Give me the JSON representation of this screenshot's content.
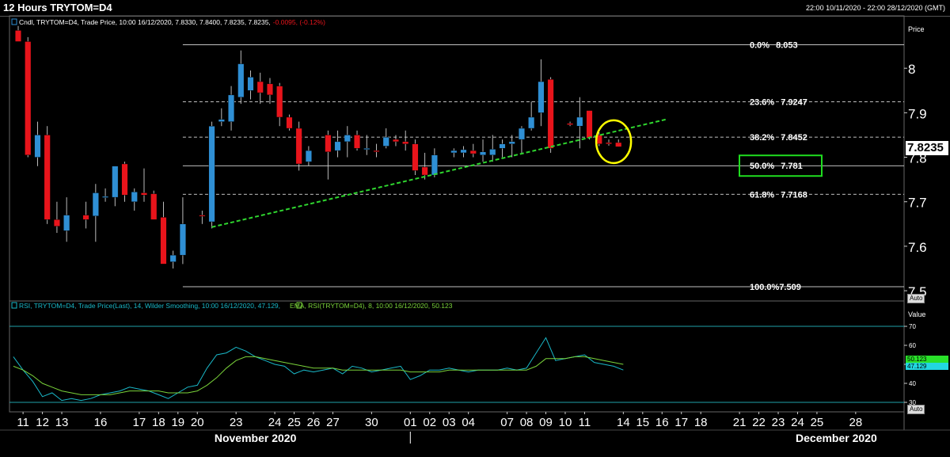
{
  "header": {
    "title": "12 Hours TRYTOM=D4",
    "date_range": "22:00 10/11/2020 - 22:00 28/12/2020 (GMT)"
  },
  "price_panel": {
    "legend_prefix": "Cndl, TRYTOM=D4, Trade Price, 10:00 16/12/2020, 7.8330, 7.8400, 7.8235, 7.8235,",
    "legend_change": "-0.0095, (-0.12%)",
    "axis_title": "Price",
    "current_price": "7.8235",
    "auto_label": "Auto"
  },
  "rsi_panel": {
    "legend_rsi": "RSI, TRYTOM=D4, Trade Price(Last), 14, Wilder Smoothing, 10:00 16/12/2020, 47.129,",
    "legend_ema": "EMA, RSI(TRYTOM=D4), 8, 10:00 16/12/2020, 50.123",
    "axis_title": "Value",
    "ema_value": "50.123",
    "rsi_value": "47.129",
    "auto_label": "Auto"
  },
  "x_axis": {
    "month_labels": [
      {
        "text": "November 2020",
        "x": 16.5
      },
      {
        "text": "December 2020",
        "x": 46.5
      }
    ]
  },
  "colors": {
    "up": "#2f8fd4",
    "down": "#e8141b",
    "trendline": "#2fd62f",
    "fib": "#ffffff",
    "highlight_circle": "#ffff00",
    "highlight_box": "#1fdc1f",
    "rsi_line": "#19b8c8",
    "ema_line": "#7ad33a",
    "rsi_bands": "#1f9fa8"
  },
  "chart_data": [
    {
      "type": "candlestick",
      "x_unit": "trading-slot index (2 twelve-hour candles per day)",
      "x_ticks": [
        {
          "x": 0.5,
          "label": "11"
        },
        {
          "x": 1.5,
          "label": "12"
        },
        {
          "x": 2.5,
          "label": "13"
        },
        {
          "x": 4.5,
          "label": "16"
        },
        {
          "x": 6.5,
          "label": "17"
        },
        {
          "x": 7.5,
          "label": "18"
        },
        {
          "x": 8.5,
          "label": "19"
        },
        {
          "x": 9.5,
          "label": "20"
        },
        {
          "x": 11.5,
          "label": "23"
        },
        {
          "x": 13.5,
          "label": "24"
        },
        {
          "x": 14.5,
          "label": "25"
        },
        {
          "x": 15.5,
          "label": "26"
        },
        {
          "x": 16.5,
          "label": "27"
        },
        {
          "x": 18.5,
          "label": "30"
        },
        {
          "x": 20.5,
          "label": "01"
        },
        {
          "x": 21.5,
          "label": "02"
        },
        {
          "x": 22.5,
          "label": "03"
        },
        {
          "x": 23.5,
          "label": "04"
        },
        {
          "x": 25.5,
          "label": "07"
        },
        {
          "x": 26.5,
          "label": "08"
        },
        {
          "x": 27.5,
          "label": "09"
        },
        {
          "x": 28.5,
          "label": "10"
        },
        {
          "x": 29.5,
          "label": "11"
        },
        {
          "x": 31.5,
          "label": "14"
        },
        {
          "x": 32.5,
          "label": "15"
        },
        {
          "x": 33.5,
          "label": "16"
        },
        {
          "x": 34.5,
          "label": "17"
        },
        {
          "x": 35.5,
          "label": "18"
        },
        {
          "x": 37.5,
          "label": "21"
        },
        {
          "x": 38.5,
          "label": "22"
        },
        {
          "x": 39.5,
          "label": "23"
        },
        {
          "x": 40.5,
          "label": "24"
        },
        {
          "x": 41.5,
          "label": "25"
        },
        {
          "x": 43.5,
          "label": "28"
        }
      ],
      "x_range": [
        -0.2,
        46.0
      ],
      "y_ticks": [
        7.5,
        7.6,
        7.7,
        7.8,
        7.9,
        8.0
      ],
      "y_tick_labels": [
        "7.5",
        "7.6",
        "7.7",
        "7.8",
        "7.9",
        "8"
      ],
      "ylim": [
        7.477,
        8.1
      ],
      "candles": [
        {
          "x": 0.25,
          "o": 8.085,
          "h": 8.095,
          "l": 8.06,
          "c": 8.06
        },
        {
          "x": 0.75,
          "o": 8.06,
          "h": 8.07,
          "l": 7.8,
          "c": 7.805
        },
        {
          "x": 1.25,
          "o": 7.8,
          "h": 7.88,
          "l": 7.78,
          "c": 7.85
        },
        {
          "x": 1.75,
          "o": 7.85,
          "h": 7.87,
          "l": 7.65,
          "c": 7.66
        },
        {
          "x": 2.25,
          "o": 7.66,
          "h": 7.7,
          "l": 7.63,
          "c": 7.645
        },
        {
          "x": 2.75,
          "o": 7.635,
          "h": 7.71,
          "l": 7.61,
          "c": 7.67
        },
        {
          "x": 3.75,
          "o": 7.67,
          "h": 7.7,
          "l": 7.64,
          "c": 7.66
        },
        {
          "x": 4.25,
          "o": 7.668,
          "h": 7.74,
          "l": 7.61,
          "c": 7.72
        },
        {
          "x": 4.75,
          "o": 7.71,
          "h": 7.73,
          "l": 7.7,
          "c": 7.712
        },
        {
          "x": 5.25,
          "o": 7.71,
          "h": 7.78,
          "l": 7.69,
          "c": 7.78
        },
        {
          "x": 5.75,
          "o": 7.785,
          "h": 7.79,
          "l": 7.7,
          "c": 7.715
        },
        {
          "x": 6.25,
          "o": 7.7,
          "h": 7.73,
          "l": 7.68,
          "c": 7.722
        },
        {
          "x": 6.75,
          "o": 7.72,
          "h": 7.775,
          "l": 7.7,
          "c": 7.715
        },
        {
          "x": 7.25,
          "o": 7.718,
          "h": 7.725,
          "l": 7.66,
          "c": 7.66
        },
        {
          "x": 7.75,
          "o": 7.665,
          "h": 7.7,
          "l": 7.62,
          "c": 7.56
        },
        {
          "x": 8.25,
          "o": 7.565,
          "h": 7.59,
          "l": 7.55,
          "c": 7.58
        },
        {
          "x": 8.75,
          "o": 7.58,
          "h": 7.71,
          "l": 7.56,
          "c": 7.65
        },
        {
          "x": 9.75,
          "o": 7.67,
          "h": 7.68,
          "l": 7.65,
          "c": 7.668
        },
        {
          "x": 10.25,
          "o": 7.655,
          "h": 7.88,
          "l": 7.64,
          "c": 7.87
        },
        {
          "x": 10.75,
          "o": 7.88,
          "h": 7.91,
          "l": 7.87,
          "c": 7.885
        },
        {
          "x": 11.25,
          "o": 7.88,
          "h": 7.96,
          "l": 7.86,
          "c": 7.94
        },
        {
          "x": 11.75,
          "o": 7.935,
          "h": 8.04,
          "l": 7.92,
          "c": 8.01
        },
        {
          "x": 12.25,
          "o": 7.95,
          "h": 7.995,
          "l": 7.93,
          "c": 7.98
        },
        {
          "x": 12.75,
          "o": 7.97,
          "h": 7.99,
          "l": 7.92,
          "c": 7.945
        },
        {
          "x": 13.25,
          "o": 7.965,
          "h": 7.978,
          "l": 7.92,
          "c": 7.94
        },
        {
          "x": 13.75,
          "o": 7.96,
          "h": 7.967,
          "l": 7.87,
          "c": 7.89
        },
        {
          "x": 14.25,
          "o": 7.89,
          "h": 7.896,
          "l": 7.86,
          "c": 7.865
        },
        {
          "x": 14.75,
          "o": 7.865,
          "h": 7.88,
          "l": 7.77,
          "c": 7.785
        },
        {
          "x": 15.25,
          "o": 7.79,
          "h": 7.825,
          "l": 7.78,
          "c": 7.815
        },
        {
          "x": 16.25,
          "o": 7.85,
          "h": 7.86,
          "l": 7.75,
          "c": 7.812
        },
        {
          "x": 16.75,
          "o": 7.815,
          "h": 7.86,
          "l": 7.8,
          "c": 7.835
        },
        {
          "x": 17.25,
          "o": 7.835,
          "h": 7.87,
          "l": 7.8,
          "c": 7.85
        },
        {
          "x": 17.75,
          "o": 7.85,
          "h": 7.86,
          "l": 7.815,
          "c": 7.82
        },
        {
          "x": 18.25,
          "o": 7.818,
          "h": 7.85,
          "l": 7.805,
          "c": 7.82
        },
        {
          "x": 18.75,
          "o": 7.815,
          "h": 7.83,
          "l": 7.8,
          "c": 7.813
        },
        {
          "x": 19.25,
          "o": 7.825,
          "h": 7.865,
          "l": 7.82,
          "c": 7.845
        },
        {
          "x": 19.75,
          "o": 7.84,
          "h": 7.85,
          "l": 7.825,
          "c": 7.835
        },
        {
          "x": 20.25,
          "o": 7.835,
          "h": 7.86,
          "l": 7.815,
          "c": 7.83
        },
        {
          "x": 20.75,
          "o": 7.83,
          "h": 7.84,
          "l": 7.76,
          "c": 7.77
        },
        {
          "x": 21.25,
          "o": 7.778,
          "h": 7.81,
          "l": 7.75,
          "c": 7.76
        },
        {
          "x": 21.75,
          "o": 7.76,
          "h": 7.82,
          "l": 7.755,
          "c": 7.805
        },
        {
          "x": 22.75,
          "o": 7.81,
          "h": 7.82,
          "l": 7.8,
          "c": 7.815
        },
        {
          "x": 23.25,
          "o": 7.81,
          "h": 7.825,
          "l": 7.8,
          "c": 7.817
        },
        {
          "x": 23.75,
          "o": 7.815,
          "h": 7.83,
          "l": 7.8,
          "c": 7.808
        },
        {
          "x": 24.25,
          "o": 7.805,
          "h": 7.84,
          "l": 7.79,
          "c": 7.812
        },
        {
          "x": 24.75,
          "o": 7.805,
          "h": 7.85,
          "l": 7.79,
          "c": 7.818
        },
        {
          "x": 25.25,
          "o": 7.82,
          "h": 7.84,
          "l": 7.8,
          "c": 7.83
        },
        {
          "x": 25.75,
          "o": 7.83,
          "h": 7.85,
          "l": 7.8,
          "c": 7.835
        },
        {
          "x": 26.25,
          "o": 7.84,
          "h": 7.87,
          "l": 7.81,
          "c": 7.865
        },
        {
          "x": 26.75,
          "o": 7.865,
          "h": 7.925,
          "l": 7.86,
          "c": 7.89
        },
        {
          "x": 27.25,
          "o": 7.9,
          "h": 8.02,
          "l": 7.87,
          "c": 7.97
        },
        {
          "x": 27.75,
          "o": 7.975,
          "h": 7.98,
          "l": 7.81,
          "c": 7.82
        },
        {
          "x": 28.75,
          "o": 7.876,
          "h": 7.88,
          "l": 7.87,
          "c": 7.873
        },
        {
          "x": 29.25,
          "o": 7.87,
          "h": 7.935,
          "l": 7.82,
          "c": 7.89
        },
        {
          "x": 29.75,
          "o": 7.905,
          "h": 7.905,
          "l": 7.84,
          "c": 7.843
        },
        {
          "x": 30.25,
          "o": 7.85,
          "h": 7.856,
          "l": 7.825,
          "c": 7.83
        },
        {
          "x": 30.75,
          "o": 7.833,
          "h": 7.84,
          "l": 7.826,
          "c": 7.83
        },
        {
          "x": 31.25,
          "o": 7.833,
          "h": 7.84,
          "l": 7.8235,
          "c": 7.8235
        }
      ],
      "fib_levels": [
        {
          "label": "0.0%",
          "value": "8.053",
          "price": 8.053,
          "style": "solid"
        },
        {
          "label": "23.6%",
          "value": "7.9247",
          "price": 7.9247,
          "style": "dashed"
        },
        {
          "label": "38.2%",
          "value": "7.8452",
          "price": 7.8452,
          "style": "dashed"
        },
        {
          "label": "50.0%",
          "value": "7.781",
          "price": 7.781,
          "style": "solid"
        },
        {
          "label": "61.8%",
          "value": "7.7168",
          "price": 7.7168,
          "style": "dashed"
        },
        {
          "label": "100.0%",
          "value": "7.509",
          "price": 7.509,
          "style": "solid"
        }
      ],
      "fib_x_start": 8.75,
      "trendline": {
        "x1": 10.25,
        "y1": 7.643,
        "x2": 33.8,
        "y2": 7.886
      },
      "highlight_circle": {
        "x": 31.0,
        "y": 7.835,
        "r_x": 0.9,
        "r_price": 0.048
      },
      "highlight_box_level": "50.0%"
    },
    {
      "type": "line",
      "series": [
        {
          "name": "RSI",
          "x": [
            0,
            0.5,
            1,
            1.5,
            2,
            2.5,
            3,
            3.5,
            4,
            4.5,
            5,
            5.5,
            6,
            6.5,
            7,
            7.5,
            8,
            8.5,
            9,
            9.5,
            10,
            10.5,
            11,
            11.5,
            12,
            12.5,
            13,
            13.5,
            14,
            14.5,
            15,
            15.5,
            16,
            16.5,
            17,
            17.5,
            18,
            18.5,
            19,
            19.5,
            20,
            20.5,
            21,
            21.5,
            22,
            22.5,
            23,
            23.5,
            24,
            24.5,
            25,
            25.5,
            26,
            26.5,
            27,
            27.5,
            28,
            28.5,
            29,
            29.5,
            30,
            30.5,
            31,
            31.5
          ],
          "values": [
            54,
            47,
            41,
            33,
            35,
            31,
            32,
            31,
            32,
            34,
            35,
            36,
            38,
            37,
            36,
            34,
            32,
            35,
            38,
            39,
            48,
            55,
            56,
            59,
            57,
            54,
            52,
            50,
            49,
            45,
            47,
            46,
            47,
            48,
            45,
            49,
            48,
            46,
            47,
            48,
            49,
            42,
            44,
            47,
            47,
            48,
            47,
            46,
            47,
            47,
            47,
            48,
            47,
            48,
            56,
            64,
            52,
            53,
            54,
            55,
            51,
            50,
            49,
            47
          ]
        },
        {
          "name": "EMA",
          "x": [
            0,
            0.5,
            1,
            1.5,
            2,
            2.5,
            3,
            3.5,
            4,
            4.5,
            5,
            5.5,
            6,
            6.5,
            7,
            7.5,
            8,
            8.5,
            9,
            9.5,
            10,
            10.5,
            11,
            11.5,
            12,
            12.5,
            13,
            13.5,
            14,
            14.5,
            15,
            15.5,
            16,
            16.5,
            17,
            17.5,
            18,
            18.5,
            19,
            19.5,
            20,
            20.5,
            21,
            21.5,
            22,
            22.5,
            23,
            23.5,
            24,
            24.5,
            25,
            25.5,
            26,
            26.5,
            27,
            27.5,
            28,
            28.5,
            29,
            29.5,
            30,
            30.5,
            31,
            31.5
          ],
          "values": [
            49,
            47,
            44,
            40,
            38,
            36,
            35,
            34,
            34,
            34,
            34,
            35,
            36,
            36,
            36,
            36,
            35,
            35,
            35,
            36,
            39,
            43,
            48,
            52,
            54,
            54,
            53,
            52,
            51,
            50,
            49,
            48,
            48,
            48,
            47,
            47,
            47,
            47,
            47,
            47,
            47,
            46,
            46,
            46,
            46,
            47,
            47,
            47,
            47,
            47,
            47,
            47,
            47,
            47,
            49,
            53,
            53,
            53,
            54,
            54,
            53,
            52,
            51,
            50
          ]
        }
      ],
      "y_ticks": [
        30,
        40,
        50,
        60,
        70
      ],
      "ylim": [
        25,
        75
      ],
      "bands": [
        30,
        70
      ]
    }
  ]
}
